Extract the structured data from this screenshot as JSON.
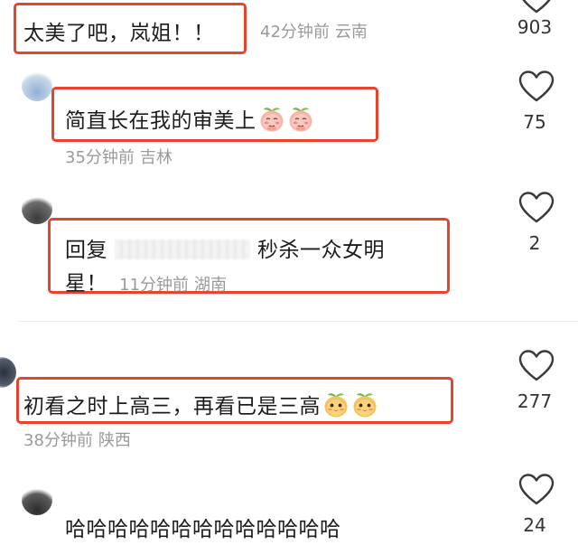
{
  "comments": [
    {
      "text": "太美了吧，岚姐！！",
      "time": "42分钟前",
      "location": "云南",
      "likes": "903"
    },
    {
      "text": "简直长在我的审美上",
      "time": "35分钟前",
      "location": "吉林",
      "likes": "75",
      "emoji": "shy-peach-emoji"
    },
    {
      "reply_prefix": "回复",
      "text_line1": "秒杀一众女明",
      "text_line2": "星！",
      "time": "11分钟前",
      "location": "湖南",
      "likes": "2"
    },
    {
      "text": "初看之时上高三，再看已是三高",
      "time": "38分钟前",
      "location": "陕西",
      "likes": "277",
      "emoji": "smiling-peach-emoji"
    },
    {
      "text": "哈哈哈哈哈哈哈哈哈哈哈哈哈",
      "likes": "24"
    }
  ],
  "colors": {
    "highlight": "#e8432b",
    "meta": "#9a9a9a",
    "text": "#1c1c1c"
  },
  "icons": [
    "heart-icon",
    "shy-peach-emoji",
    "smiling-peach-emoji",
    "avatar"
  ]
}
